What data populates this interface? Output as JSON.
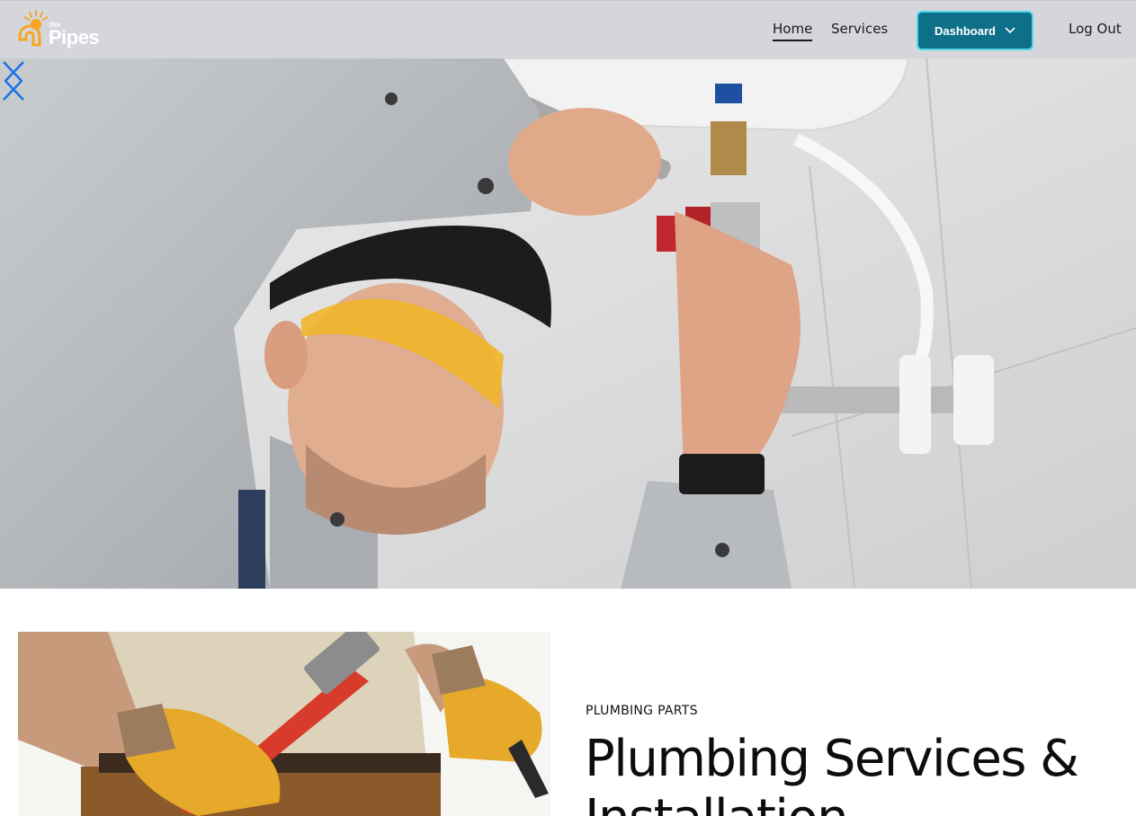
{
  "brand": {
    "name_small": "the",
    "name_main": "Pipes",
    "logo_color": "#f5a623"
  },
  "nav": {
    "home": "Home",
    "services": "Services",
    "dashboard": "Dashboard",
    "logout": "Log Out",
    "active": "Home"
  },
  "colors": {
    "navbar_bg": "#d4d6dc",
    "dashboard_bg": "#0e6f89",
    "dashboard_border": "#4fd6e8",
    "arrow": "#1a73e8"
  },
  "hero": {
    "carousel_prev_icon": "chevron-left-icon",
    "carousel_next_icon": "chevron-right-icon"
  },
  "section": {
    "eyebrow": "PLUMBING PARTS",
    "heading": "Plumbing Services & Installation"
  }
}
